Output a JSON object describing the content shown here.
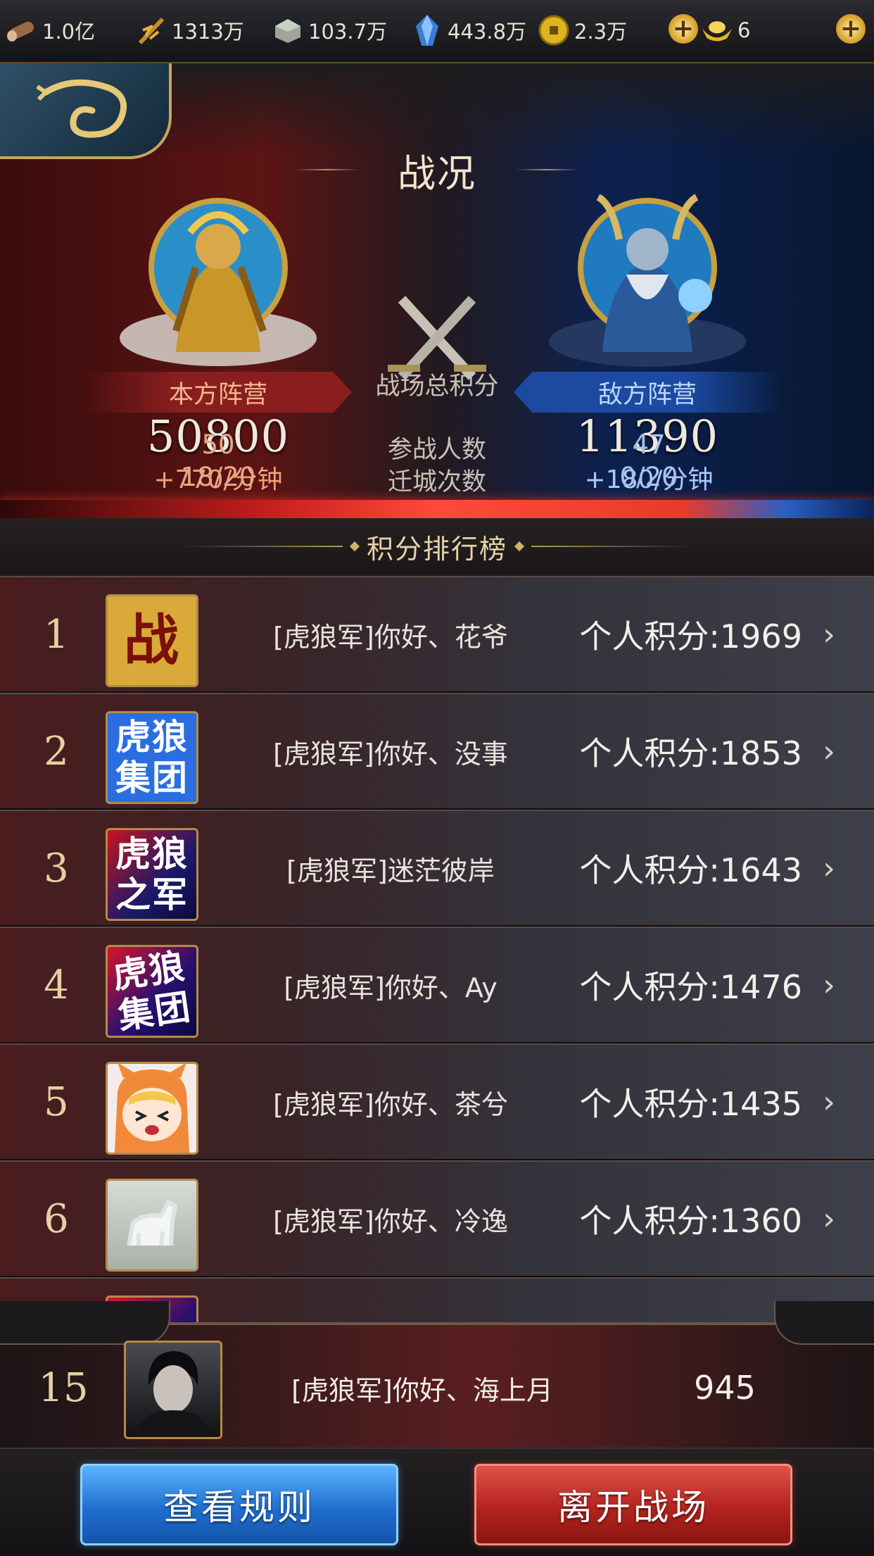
{
  "resources": [
    {
      "icon": "wood-icon",
      "value": "1.0亿"
    },
    {
      "icon": "grain-icon",
      "value": "1313万"
    },
    {
      "icon": "iron-icon",
      "value": "103.7万"
    },
    {
      "icon": "crystal-icon",
      "value": "443.8万"
    },
    {
      "icon": "coin-icon",
      "value": "2.3万"
    },
    {
      "icon": "gold-ingot-icon",
      "value": "6"
    }
  ],
  "header": {
    "title": "战况"
  },
  "battle": {
    "total_label": "战场总积分",
    "participants_label": "参战人数",
    "relocate_label": "迁城次数",
    "mine": {
      "camp": "本方阵营",
      "score": "50800",
      "rate": "+770/分钟",
      "participants": "50",
      "relocations": "18/20"
    },
    "enemy": {
      "camp": "敌方阵营",
      "score": "11390",
      "rate": "+180/分钟",
      "participants": "47",
      "relocations": "0/20"
    }
  },
  "ranking": {
    "title": "积分排行榜",
    "score_prefix": "个人积分:",
    "rows": [
      {
        "rank": "1",
        "name": "[虎狼军]你好、花爷",
        "score": "个人积分:1969",
        "avatar_text": "战"
      },
      {
        "rank": "2",
        "name": "[虎狼军]你好、没事",
        "score": "个人积分:1853",
        "avatar_text": "虎狼集团"
      },
      {
        "rank": "3",
        "name": "[虎狼军]迷茫彼岸",
        "score": "个人积分:1643",
        "avatar_text": "虎狼之军"
      },
      {
        "rank": "4",
        "name": "[虎狼军]你好、Ay",
        "score": "个人积分:1476",
        "avatar_text": "虎狼集团"
      },
      {
        "rank": "5",
        "name": "[虎狼军]你好、茶兮",
        "score": "个人积分:1435",
        "avatar_text": ""
      },
      {
        "rank": "6",
        "name": "[虎狼军]你好、冷逸",
        "score": "个人积分:1360",
        "avatar_text": ""
      }
    ]
  },
  "me": {
    "rank": "15",
    "name": "[虎狼军]你好、海上月",
    "score": "945"
  },
  "buttons": {
    "rules": "查看规则",
    "leave": "离开战场"
  }
}
